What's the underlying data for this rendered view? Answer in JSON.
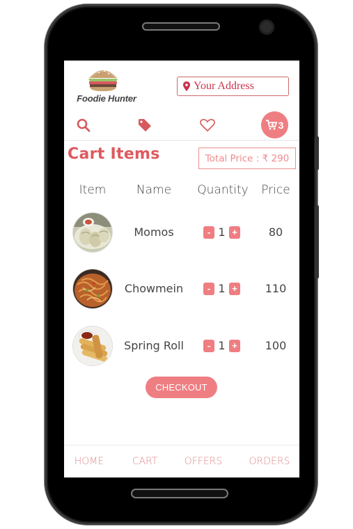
{
  "brand": {
    "name": "Foodie Hunter"
  },
  "header": {
    "address_label": "Your Address"
  },
  "toolbar": {
    "search_icon": "search-icon",
    "offers_icon": "tag-icon",
    "favorites_icon": "heart-icon",
    "cart_icon": "cart-plus-icon",
    "cart_count": "3"
  },
  "cart": {
    "title": "Cart Items",
    "total_label": "Total Price : ₹ 290",
    "columns": [
      "Item",
      "Name",
      "Quantity",
      "Price"
    ],
    "items": [
      {
        "name": "Momos",
        "quantity": "1",
        "price": "80",
        "image": "momos-photo"
      },
      {
        "name": "Chowmein",
        "quantity": "1",
        "price": "110",
        "image": "chowmein-photo"
      },
      {
        "name": "Spring Roll",
        "quantity": "1",
        "price": "100",
        "image": "spring-roll-photo"
      }
    ],
    "minus_label": "-",
    "plus_label": "+",
    "checkout_label": "CHECKOUT"
  },
  "bottom_nav": [
    "HOME",
    "CART",
    "OFFERS",
    "ORDERS"
  ],
  "colors": {
    "accent": "#ef7e82",
    "title": "#dd5a5f",
    "address": "#c8344d"
  }
}
